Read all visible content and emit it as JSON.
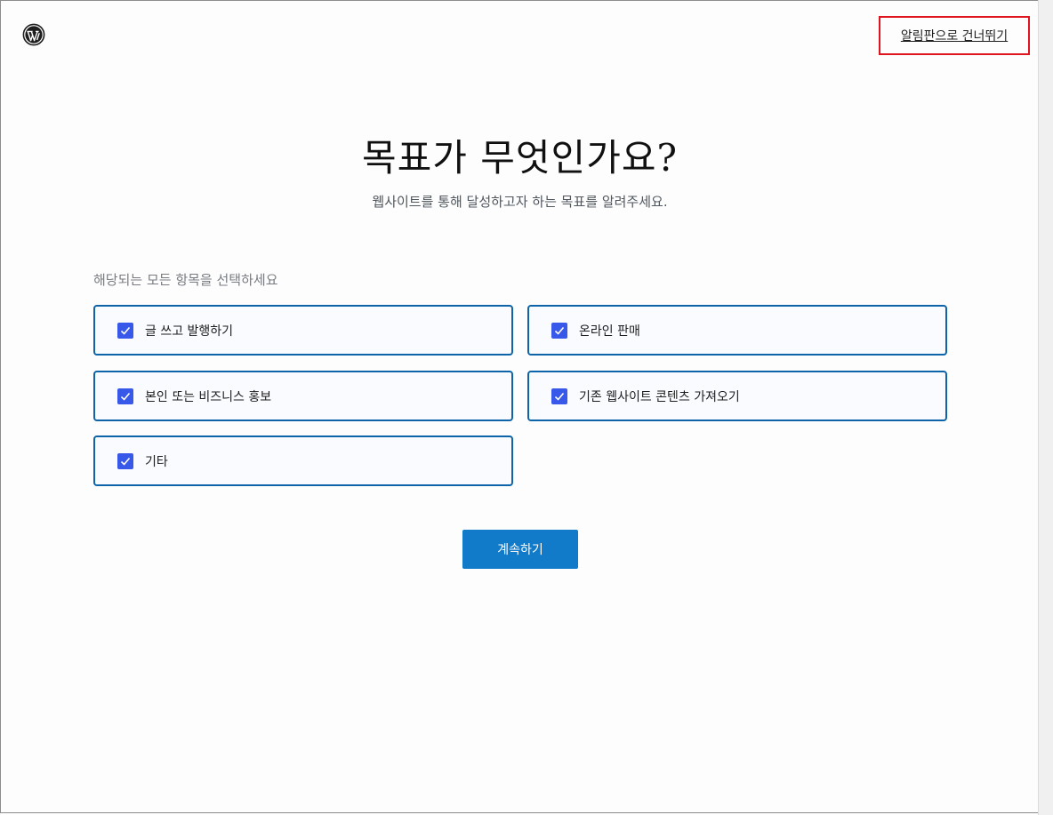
{
  "header": {
    "logo_icon": "wordpress-logo-icon",
    "skip_link": "알림판으로 건너뛰기"
  },
  "main": {
    "title": "목표가 무엇인가요?",
    "subtitle": "웹사이트를 통해 달성하고자 하는 목표를 알려주세요.",
    "select_label": "해당되는 모든 항목을 선택하세요",
    "options": [
      {
        "label": "글 쓰고 발행하기",
        "checked": true
      },
      {
        "label": "온라인 판매",
        "checked": true
      },
      {
        "label": "본인 또는 비즈니스 홍보",
        "checked": true
      },
      {
        "label": "기존 웹사이트 콘텐츠 가져오기",
        "checked": true
      },
      {
        "label": "기타",
        "checked": true
      }
    ],
    "continue_label": "계속하기"
  },
  "colors": {
    "accent": "#117ac9",
    "checkbox": "#3858e9",
    "option_border": "#0e64a8",
    "highlight": "#e0141e"
  }
}
